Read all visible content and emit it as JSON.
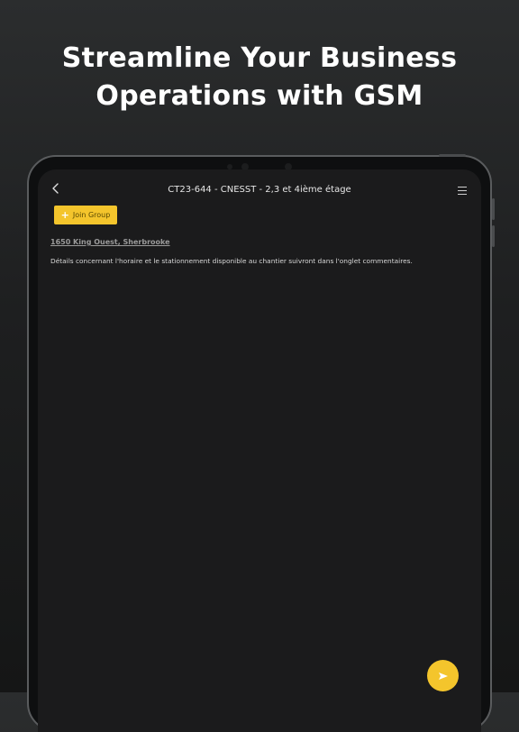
{
  "headline": {
    "line1": "Streamline Your Business",
    "line2": "Operations with GSM"
  },
  "app": {
    "title": "CT23-644 - CNESST - 2,3 et 4ième étage",
    "join_button_label": "Join Group",
    "address": "1650 King Ouest, Sherbrooke",
    "description": "Détails concernant l'horaire et le stationnement disponible au chantier suivront dans l'onglet commentaires."
  },
  "icons": {
    "back": "chevron-left-icon",
    "menu": "hamburger-menu-icon",
    "plus": "plus-icon",
    "send": "send-icon"
  },
  "colors": {
    "accent": "#f4c52c",
    "screen_bg": "#1b1b1c",
    "page_bg": "#1e1f20"
  }
}
